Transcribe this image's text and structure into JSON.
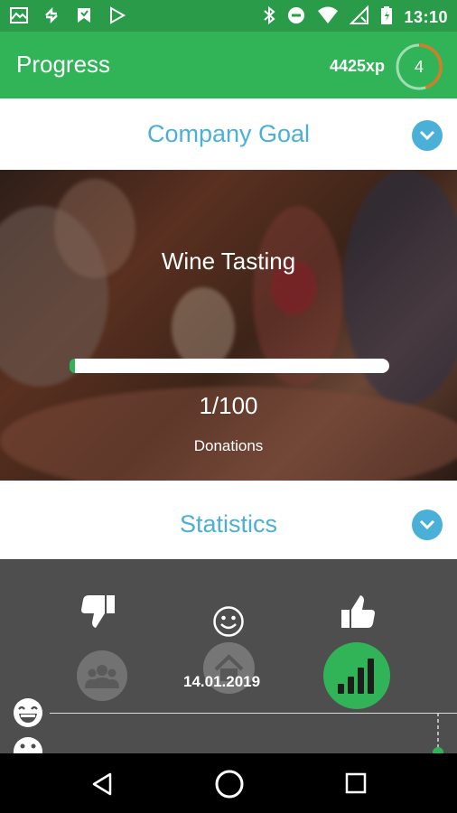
{
  "status_bar": {
    "time": "13:10",
    "icons": [
      "mail-icon",
      "sync-icon",
      "flag-icon",
      "play-store-icon",
      "bluetooth-icon",
      "do-not-disturb-icon",
      "wifi-icon",
      "no-signal-icon",
      "battery-icon"
    ]
  },
  "app_bar": {
    "title": "Progress",
    "xp": "4425xp",
    "level": "4",
    "level_progress": 0.45,
    "accent": "#30b457",
    "ring_color": "#e8731f"
  },
  "company_goal": {
    "header": "Company Goal",
    "title": "Wine Tasting",
    "count": "1/100",
    "label": "Donations",
    "progress": 0.01
  },
  "statistics": {
    "header": "Statistics",
    "date": "14.01.2019",
    "icons": [
      "thumbs-down-icon",
      "smiley-icon",
      "thumbs-up-icon",
      "group-icon",
      "home-icon",
      "signal-bars-icon",
      "grin-icon",
      "neutral-face-icon"
    ]
  },
  "colors": {
    "header_text": "#4bb0d8",
    "panel": "#4e4e4e",
    "green": "#30b457"
  }
}
